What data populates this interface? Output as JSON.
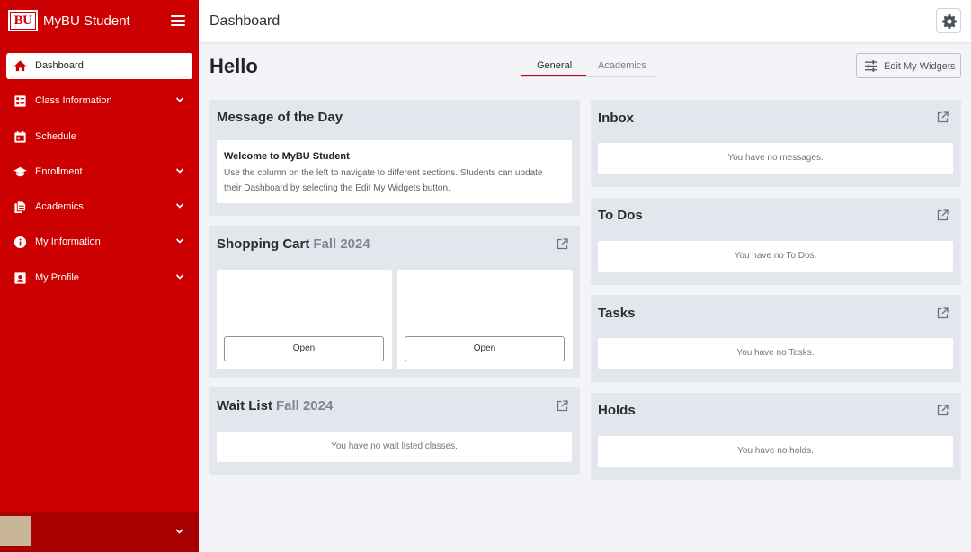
{
  "sidebar": {
    "brand_logo": "BU",
    "app_name": "MyBU Student",
    "items": [
      {
        "label": "Dashboard",
        "icon": "home-icon",
        "active": true,
        "expandable": false
      },
      {
        "label": "Class Information",
        "icon": "class-info-icon",
        "active": false,
        "expandable": true
      },
      {
        "label": "Schedule",
        "icon": "calendar-icon",
        "active": false,
        "expandable": false
      },
      {
        "label": "Enrollment",
        "icon": "graduation-cap-icon",
        "active": false,
        "expandable": true
      },
      {
        "label": "Academics",
        "icon": "documents-icon",
        "active": false,
        "expandable": true
      },
      {
        "label": "My Information",
        "icon": "info-icon",
        "active": false,
        "expandable": true
      },
      {
        "label": "My Profile",
        "icon": "profile-icon",
        "active": false,
        "expandable": true
      }
    ]
  },
  "header": {
    "title": "Dashboard",
    "settings_icon": "gear-icon"
  },
  "main": {
    "greeting": "Hello",
    "tabs": [
      {
        "label": "General",
        "active": true
      },
      {
        "label": "Academics",
        "active": false
      }
    ],
    "edit_widgets_label": "Edit My Widgets",
    "message_of_day": {
      "title": "Message of the Day",
      "heading": "Welcome to MyBU Student",
      "body": "Use the column on the left to navigate to different sections. Students can update their Dashboard by selecting the Edit My Widgets button."
    },
    "shopping_cart": {
      "title": "Shopping Cart",
      "term": "Fall 2024",
      "open_label_1": "Open",
      "open_label_2": "Open"
    },
    "wait_list": {
      "title": "Wait List",
      "term": "Fall 2024",
      "empty": "You have no wait listed classes."
    },
    "inbox": {
      "title": "Inbox",
      "empty": "You have no messages."
    },
    "todos": {
      "title": "To Dos",
      "empty": "You have no To Dos."
    },
    "tasks": {
      "title": "Tasks",
      "empty": "You have no Tasks."
    },
    "holds": {
      "title": "Holds",
      "empty": "You have no holds."
    }
  },
  "colors": {
    "brand_red": "#cc0000",
    "sidebar_footer": "#a80000",
    "card_bg": "#e4e6ee",
    "page_bg": "#f3f4f8"
  }
}
